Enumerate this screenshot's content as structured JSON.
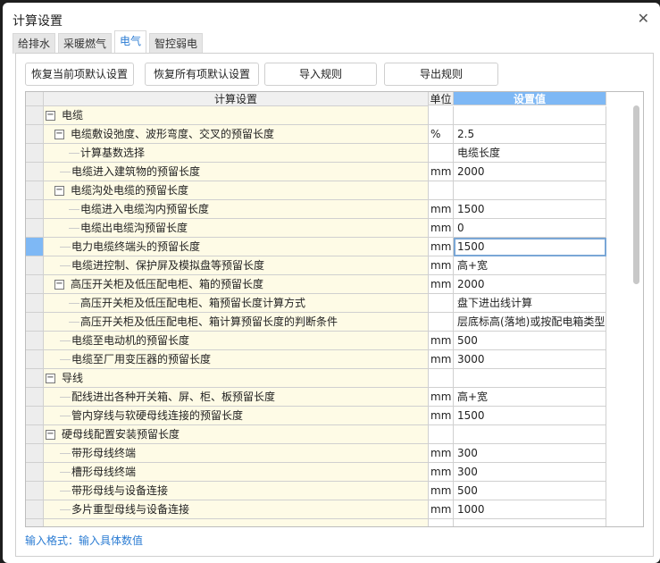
{
  "title": "计算设置",
  "tabs": [
    "给排水",
    "采暖燃气",
    "电气",
    "智控弱电"
  ],
  "active_tab": "电气",
  "buttons": {
    "restore_current": "恢复当前项默认设置",
    "restore_all": "恢复所有项默认设置",
    "import": "导入规则",
    "export": "导出规则"
  },
  "columns": {
    "name": "计算设置",
    "unit": "单位",
    "value": "设置值"
  },
  "rows": [
    {
      "level": 0,
      "expand": true,
      "name": "电缆",
      "unit": "",
      "value": ""
    },
    {
      "level": 1,
      "expand": true,
      "name": "电缆敷设弛度、波形弯度、交叉的预留长度",
      "unit": "%",
      "value": "2.5"
    },
    {
      "level": 2,
      "name": "计算基数选择",
      "unit": "",
      "value": "电缆长度"
    },
    {
      "level": 1,
      "name": "电缆进入建筑物的预留长度",
      "unit": "mm",
      "value": "2000"
    },
    {
      "level": 1,
      "expand": true,
      "name": "电缆沟处电缆的预留长度",
      "unit": "",
      "value": ""
    },
    {
      "level": 2,
      "name": "电缆进入电缆沟内预留长度",
      "unit": "mm",
      "value": "1500"
    },
    {
      "level": 2,
      "name": "电缆出电缆沟预留长度",
      "unit": "mm",
      "value": "0"
    },
    {
      "level": 1,
      "name": "电力电缆终端头的预留长度",
      "unit": "mm",
      "value": "1500",
      "selected": true
    },
    {
      "level": 1,
      "name": "电缆进控制、保护屏及模拟盘等预留长度",
      "unit": "mm",
      "value": "高+宽"
    },
    {
      "level": 1,
      "expand": true,
      "name": "高压开关柜及低压配电柜、箱的预留长度",
      "unit": "mm",
      "value": "2000"
    },
    {
      "level": 2,
      "name": "高压开关柜及低压配电柜、箱预留长度计算方式",
      "unit": "",
      "value": "盘下进出线计算"
    },
    {
      "level": 2,
      "name": "高压开关柜及低压配电柜、箱计算预留长度的判断条件",
      "unit": "",
      "value": "层底标高(落地)或按配电箱类型"
    },
    {
      "level": 1,
      "name": "电缆至电动机的预留长度",
      "unit": "mm",
      "value": "500"
    },
    {
      "level": 1,
      "name": "电缆至厂用变压器的预留长度",
      "unit": "mm",
      "value": "3000"
    },
    {
      "level": 0,
      "expand": true,
      "name": "导线",
      "unit": "",
      "value": ""
    },
    {
      "level": 1,
      "name": "配线进出各种开关箱、屏、柜、板预留长度",
      "unit": "mm",
      "value": "高+宽"
    },
    {
      "level": 1,
      "name": "管内穿线与软硬母线连接的预留长度",
      "unit": "mm",
      "value": "1500"
    },
    {
      "level": 0,
      "expand": true,
      "name": "硬母线配置安装预留长度",
      "unit": "",
      "value": ""
    },
    {
      "level": 1,
      "name": "带形母线终端",
      "unit": "mm",
      "value": "300"
    },
    {
      "level": 1,
      "name": "槽形母线终端",
      "unit": "mm",
      "value": "300"
    },
    {
      "level": 1,
      "name": "带形母线与设备连接",
      "unit": "mm",
      "value": "500"
    },
    {
      "level": 1,
      "name": "多片重型母线与设备连接",
      "unit": "mm",
      "value": "1000"
    }
  ],
  "hint": "输入格式：输入具体数值",
  "colors": {
    "accent": "#2b7cd3",
    "header_value_bg": "#7eb8f5",
    "name_bg": "#fefbe6"
  }
}
